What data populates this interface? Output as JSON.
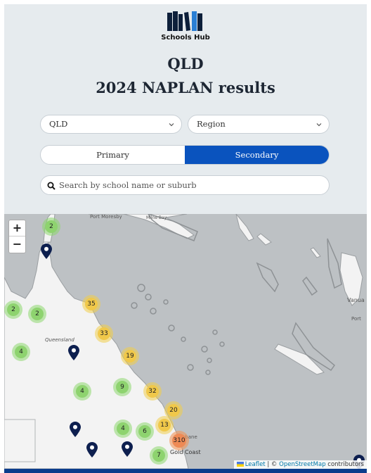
{
  "brand": {
    "name": "Schools Hub",
    "icon": "books-icon"
  },
  "heading": {
    "state": "QLD",
    "subtitle": "2024 NAPLAN results"
  },
  "filters": {
    "state_value": "QLD",
    "region_value": "Region"
  },
  "level_toggle": {
    "primary_label": "Primary",
    "secondary_label": "Secondary",
    "selected": "Secondary"
  },
  "search": {
    "placeholder": "Search by school name or suburb"
  },
  "map": {
    "zoom_in": "+",
    "zoom_out": "−",
    "labels": {
      "port_moresby": "Port Moresby",
      "milne_bay": "Milne Bay",
      "queensland": "Queensland",
      "brisbane": "Brisbane",
      "gold_coast": "Gold Coast",
      "vanuatu": "Vanua",
      "port_vila": "Port"
    },
    "clusters": [
      "2",
      "2",
      "2",
      "35",
      "33",
      "4",
      "19",
      "4",
      "9",
      "32",
      "20",
      "13",
      "4",
      "6",
      "310",
      "7"
    ],
    "attribution": {
      "leaflet": "Leaflet",
      "separator": " | © ",
      "osm": "OpenStreetMap",
      "suffix": " contributors"
    }
  },
  "colors": {
    "accent": "#0a53be",
    "pin": "#0d1f4f",
    "cluster_small": "#8ed36f",
    "cluster_medium": "#f0c84a",
    "cluster_large": "#ee8a55"
  }
}
